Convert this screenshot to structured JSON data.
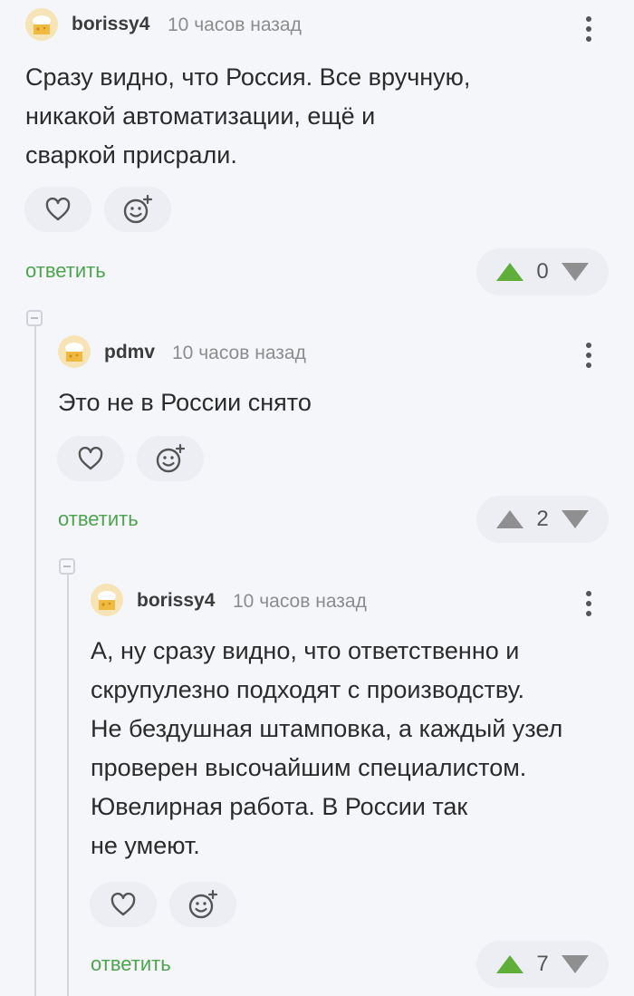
{
  "comments": [
    {
      "author": "borissy4",
      "time": "10 часов назад",
      "text": "Сразу видно, что Россия. Все вручную,\nникакой автоматизации, ещё и\nсваркой присрали.",
      "reply_label": "ответить",
      "rating": "0",
      "voted": "up"
    },
    {
      "author": "pdmv",
      "time": "10 часов назад",
      "text": "Это не в России снято",
      "reply_label": "ответить",
      "rating": "2",
      "voted": "none"
    },
    {
      "author": "borissy4",
      "time": "10 часов назад",
      "text": "А, ну сразу видно, что ответственно и\nскрупулезно подходят с производству.\nНе бездушная штамповка, а каждый узел\nпроверен высочайшим специалистом.\nЮвелирная работа. В России так\nне умеют.",
      "reply_label": "ответить",
      "rating": "7",
      "voted": "up"
    }
  ],
  "colors": {
    "accent_green": "#4ea34e",
    "vote_up_active": "#5fae3a",
    "vote_inactive": "#8f8f8f",
    "background": "#f5f6fa",
    "pill_bg": "#eceef3"
  },
  "icons": [
    "heart-icon",
    "emoji-add-icon",
    "more-vertical-icon",
    "vote-up-icon",
    "vote-down-icon",
    "collapse-icon",
    "avatar-cheese-icon"
  ]
}
